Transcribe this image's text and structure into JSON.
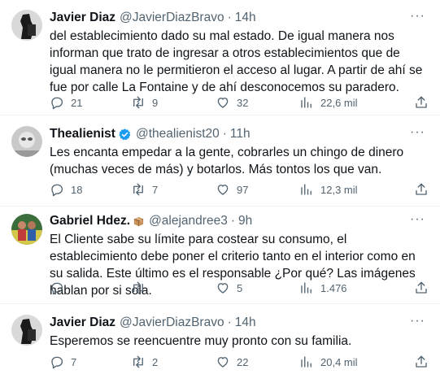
{
  "tweets": [
    {
      "name": "Javier Diaz",
      "handle": "@JavierDiazBravo",
      "sep": "·",
      "time": "14h",
      "text": "del establecimiento dado su mal estado. De igual manera nos informan que trato de ingresar a otros establecimientos que de igual manera no le permitieron el acceso al lugar. A partir de ahí se fue por calle La Fontaine y de ahí desconocemos su paradero.",
      "replies": "21",
      "retweets": "9",
      "likes": "32",
      "views": "22,6 mil"
    },
    {
      "name": "Thealienist",
      "handle": "@thealienist20",
      "sep": "·",
      "time": "11h",
      "verified": true,
      "text": "Les encanta empedar a la gente, cobrarles un chingo de dinero (muchas veces de más) y botarlos. Más tontos los que van.",
      "replies": "18",
      "retweets": "7",
      "likes": "97",
      "views": "12,3 mil"
    },
    {
      "name": "Gabriel Hdez.",
      "handle": "@alejandree3",
      "sep": "·",
      "time": "9h",
      "emoji": "package",
      "text": "El Cliente sabe su límite para costear su consumo, el establecimiento debe poner el criterio tanto en el interior como en su salida. Este último es el responsable ¿Por qué? Las imágenes hablan por si sola.",
      "replies": "",
      "retweets": "",
      "likes": "5",
      "views": "1.476"
    },
    {
      "name": "Javier Diaz",
      "handle": "@JavierDiazBravo",
      "sep": "·",
      "time": "14h",
      "text": "Esperemos se reencuentre muy pronto con su familia.",
      "replies": "7",
      "retweets": "2",
      "likes": "22",
      "views": "20,4 mil"
    }
  ],
  "more_label": "···",
  "colors": {
    "text": "#0f1419",
    "secondary": "#536471",
    "verified": "#1d9bf0",
    "divider": "#eff3f4"
  },
  "icons": [
    "reply-icon",
    "retweet-icon",
    "like-icon",
    "views-icon",
    "share-icon",
    "more-icon",
    "verified-badge-icon"
  ]
}
